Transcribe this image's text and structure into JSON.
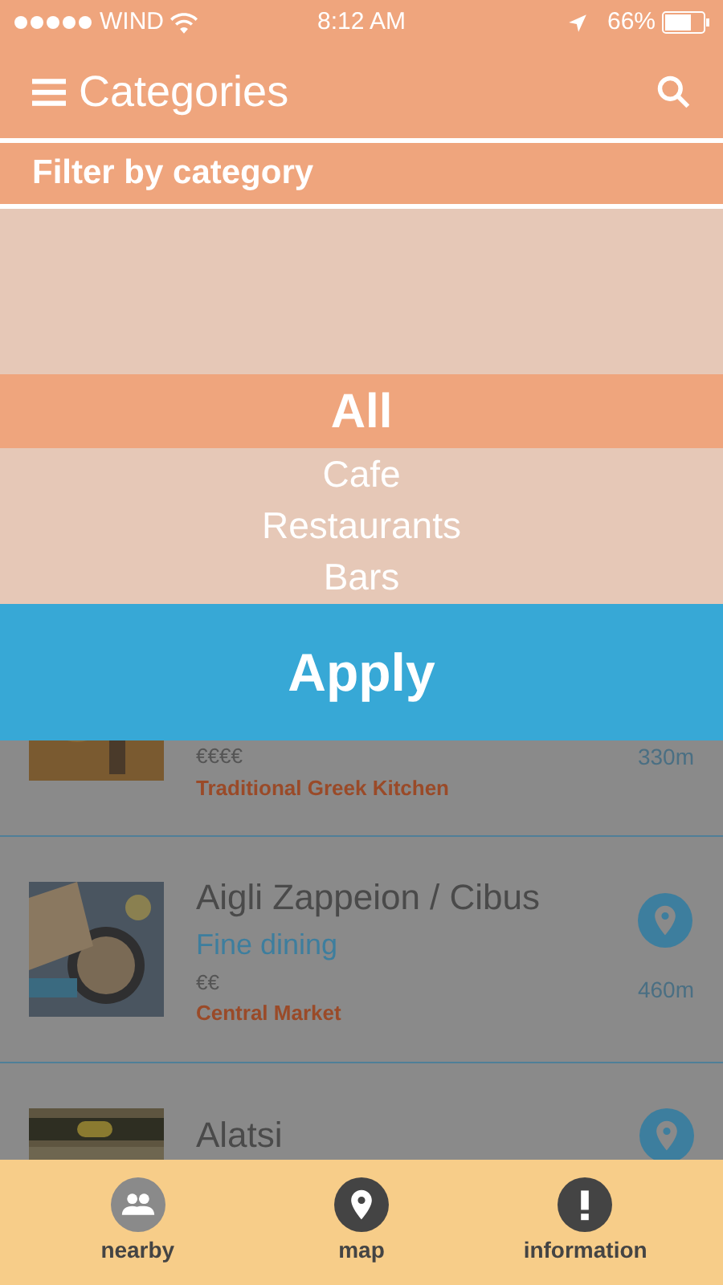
{
  "status_bar": {
    "carrier": "WIND",
    "time": "8:12 AM",
    "battery": "66%"
  },
  "header": {
    "title": "Categories"
  },
  "filter": {
    "title": "Filter by category"
  },
  "picker": {
    "options": [
      {
        "label": "All",
        "selected": true
      },
      {
        "label": "Cafe",
        "selected": false
      },
      {
        "label": "Restaurants",
        "selected": false
      },
      {
        "label": "Bars",
        "selected": false
      }
    ]
  },
  "apply_button": "Apply",
  "places": [
    {
      "kind": "partial",
      "price": "€€€€",
      "area": "Traditional Greek Kitchen",
      "distance": "330m"
    },
    {
      "kind": "full",
      "name": "Aigli Zappeion / Cibus",
      "category": "Fine dining",
      "price": "€€",
      "area": "Central Market",
      "distance": "460m"
    },
    {
      "kind": "top",
      "name": "Alatsi"
    }
  ],
  "tabs": [
    {
      "label": "nearby",
      "selected": true
    },
    {
      "label": "map",
      "selected": false
    },
    {
      "label": "information",
      "selected": false
    }
  ]
}
